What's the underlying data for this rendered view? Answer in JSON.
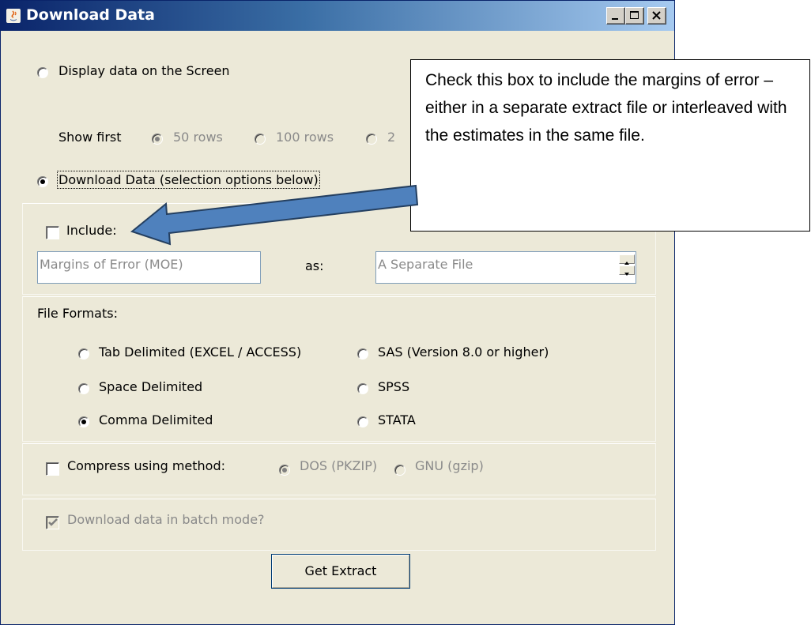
{
  "window": {
    "title": "Download Data",
    "controls": [
      "minimize-icon",
      "maximize-icon",
      "close-icon"
    ]
  },
  "display_option": {
    "label": "Display data on the Screen",
    "selected": false
  },
  "show_first": {
    "label": "Show first",
    "options": [
      {
        "label": "50 rows",
        "selected": true
      },
      {
        "label": "100 rows",
        "selected": false
      },
      {
        "label": "2",
        "selected": false
      }
    ]
  },
  "download_option": {
    "label": "Download Data (selection options below)",
    "selected": true
  },
  "include": {
    "label": "Include:",
    "checked": false,
    "field_value": "Margins of Error (MOE)",
    "as_label": "as:",
    "as_value": "A Separate File"
  },
  "file_formats": {
    "label": "File Formats:",
    "options": [
      {
        "label": "Tab Delimited (EXCEL / ACCESS)",
        "selected": false
      },
      {
        "label": "SAS  (Version 8.0 or higher)",
        "selected": false
      },
      {
        "label": "Space Delimited",
        "selected": false
      },
      {
        "label": "SPSS",
        "selected": false
      },
      {
        "label": "Comma Delimited",
        "selected": true
      },
      {
        "label": "STATA",
        "selected": false
      }
    ]
  },
  "compress": {
    "label": "Compress using method:",
    "checked": false,
    "methods": [
      {
        "label": "DOS (PKZIP)",
        "selected": true
      },
      {
        "label": "GNU (gzip)",
        "selected": false
      }
    ]
  },
  "batch": {
    "label": "Download data in batch mode?",
    "checked": true
  },
  "get_extract_label": "Get Extract",
  "callout": {
    "text": "Check this box to include the margins of error – either in a separate extract file or interleaved with the estimates in the same file."
  },
  "colors": {
    "arrow_fill": "#4f81bd",
    "arrow_stroke": "#243f60",
    "title_bar": "#0a246a"
  }
}
